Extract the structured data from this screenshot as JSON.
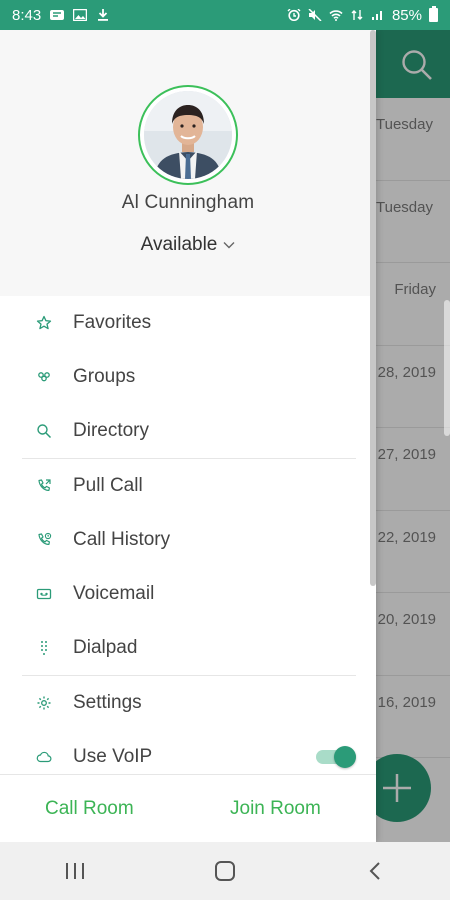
{
  "status_bar": {
    "time": "8:43",
    "battery": "85%"
  },
  "background": {
    "list_dates": [
      "Tuesday",
      "Tuesday",
      "Friday",
      "28, 2019",
      "27, 2019",
      "22, 2019",
      "20, 2019",
      "16, 2019"
    ]
  },
  "profile": {
    "name": "Al Cunningham",
    "presence": "Available"
  },
  "menu": {
    "favorites": "Favorites",
    "groups": "Groups",
    "directory": "Directory",
    "pull_call": "Pull Call",
    "call_history": "Call History",
    "voicemail": "Voicemail",
    "dialpad": "Dialpad",
    "settings": "Settings",
    "use_voip": "Use VoIP"
  },
  "toggles": {
    "use_voip_on": true
  },
  "actions": {
    "call_room": "Call Room",
    "join_room": "Join Room"
  },
  "colors": {
    "accent": "#2b9b78",
    "action_text": "#3cb455",
    "presence_ring": "#3cc05a"
  }
}
